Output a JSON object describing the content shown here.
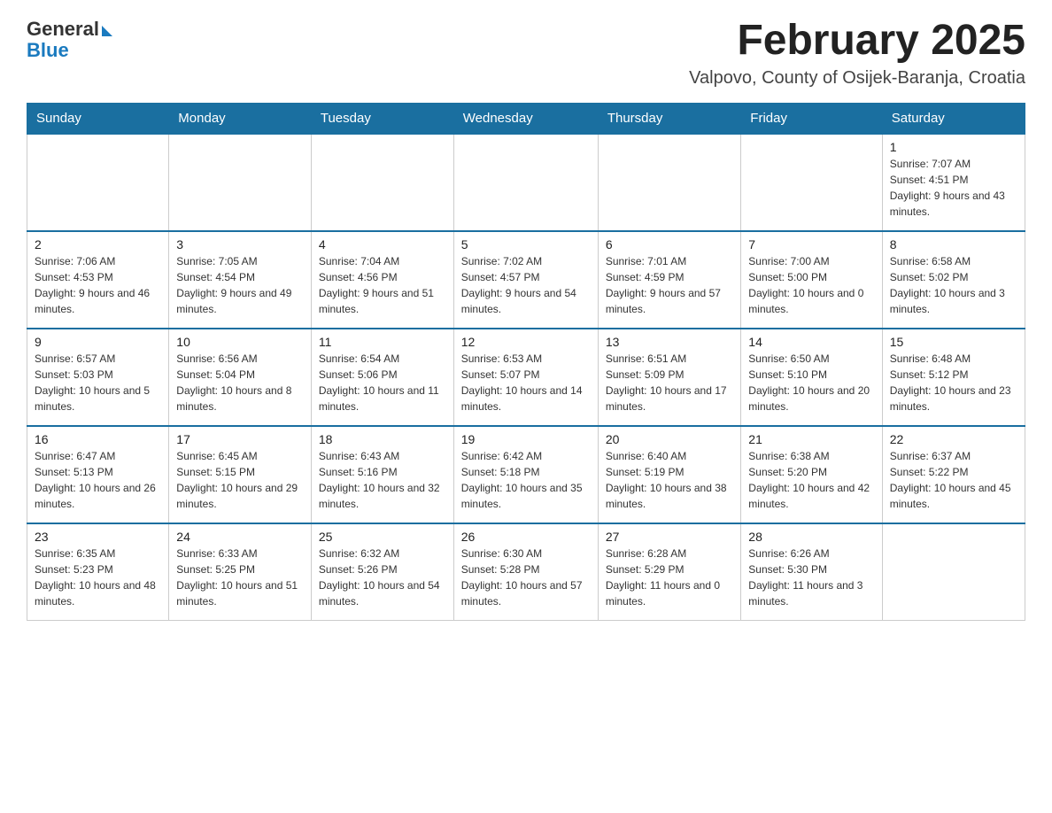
{
  "header": {
    "logo_general": "General",
    "logo_blue": "Blue",
    "month_title": "February 2025",
    "location": "Valpovo, County of Osijek-Baranja, Croatia"
  },
  "days_of_week": [
    "Sunday",
    "Monday",
    "Tuesday",
    "Wednesday",
    "Thursday",
    "Friday",
    "Saturday"
  ],
  "weeks": [
    [
      {
        "day": "",
        "info": ""
      },
      {
        "day": "",
        "info": ""
      },
      {
        "day": "",
        "info": ""
      },
      {
        "day": "",
        "info": ""
      },
      {
        "day": "",
        "info": ""
      },
      {
        "day": "",
        "info": ""
      },
      {
        "day": "1",
        "info": "Sunrise: 7:07 AM\nSunset: 4:51 PM\nDaylight: 9 hours and 43 minutes."
      }
    ],
    [
      {
        "day": "2",
        "info": "Sunrise: 7:06 AM\nSunset: 4:53 PM\nDaylight: 9 hours and 46 minutes."
      },
      {
        "day": "3",
        "info": "Sunrise: 7:05 AM\nSunset: 4:54 PM\nDaylight: 9 hours and 49 minutes."
      },
      {
        "day": "4",
        "info": "Sunrise: 7:04 AM\nSunset: 4:56 PM\nDaylight: 9 hours and 51 minutes."
      },
      {
        "day": "5",
        "info": "Sunrise: 7:02 AM\nSunset: 4:57 PM\nDaylight: 9 hours and 54 minutes."
      },
      {
        "day": "6",
        "info": "Sunrise: 7:01 AM\nSunset: 4:59 PM\nDaylight: 9 hours and 57 minutes."
      },
      {
        "day": "7",
        "info": "Sunrise: 7:00 AM\nSunset: 5:00 PM\nDaylight: 10 hours and 0 minutes."
      },
      {
        "day": "8",
        "info": "Sunrise: 6:58 AM\nSunset: 5:02 PM\nDaylight: 10 hours and 3 minutes."
      }
    ],
    [
      {
        "day": "9",
        "info": "Sunrise: 6:57 AM\nSunset: 5:03 PM\nDaylight: 10 hours and 5 minutes."
      },
      {
        "day": "10",
        "info": "Sunrise: 6:56 AM\nSunset: 5:04 PM\nDaylight: 10 hours and 8 minutes."
      },
      {
        "day": "11",
        "info": "Sunrise: 6:54 AM\nSunset: 5:06 PM\nDaylight: 10 hours and 11 minutes."
      },
      {
        "day": "12",
        "info": "Sunrise: 6:53 AM\nSunset: 5:07 PM\nDaylight: 10 hours and 14 minutes."
      },
      {
        "day": "13",
        "info": "Sunrise: 6:51 AM\nSunset: 5:09 PM\nDaylight: 10 hours and 17 minutes."
      },
      {
        "day": "14",
        "info": "Sunrise: 6:50 AM\nSunset: 5:10 PM\nDaylight: 10 hours and 20 minutes."
      },
      {
        "day": "15",
        "info": "Sunrise: 6:48 AM\nSunset: 5:12 PM\nDaylight: 10 hours and 23 minutes."
      }
    ],
    [
      {
        "day": "16",
        "info": "Sunrise: 6:47 AM\nSunset: 5:13 PM\nDaylight: 10 hours and 26 minutes."
      },
      {
        "day": "17",
        "info": "Sunrise: 6:45 AM\nSunset: 5:15 PM\nDaylight: 10 hours and 29 minutes."
      },
      {
        "day": "18",
        "info": "Sunrise: 6:43 AM\nSunset: 5:16 PM\nDaylight: 10 hours and 32 minutes."
      },
      {
        "day": "19",
        "info": "Sunrise: 6:42 AM\nSunset: 5:18 PM\nDaylight: 10 hours and 35 minutes."
      },
      {
        "day": "20",
        "info": "Sunrise: 6:40 AM\nSunset: 5:19 PM\nDaylight: 10 hours and 38 minutes."
      },
      {
        "day": "21",
        "info": "Sunrise: 6:38 AM\nSunset: 5:20 PM\nDaylight: 10 hours and 42 minutes."
      },
      {
        "day": "22",
        "info": "Sunrise: 6:37 AM\nSunset: 5:22 PM\nDaylight: 10 hours and 45 minutes."
      }
    ],
    [
      {
        "day": "23",
        "info": "Sunrise: 6:35 AM\nSunset: 5:23 PM\nDaylight: 10 hours and 48 minutes."
      },
      {
        "day": "24",
        "info": "Sunrise: 6:33 AM\nSunset: 5:25 PM\nDaylight: 10 hours and 51 minutes."
      },
      {
        "day": "25",
        "info": "Sunrise: 6:32 AM\nSunset: 5:26 PM\nDaylight: 10 hours and 54 minutes."
      },
      {
        "day": "26",
        "info": "Sunrise: 6:30 AM\nSunset: 5:28 PM\nDaylight: 10 hours and 57 minutes."
      },
      {
        "day": "27",
        "info": "Sunrise: 6:28 AM\nSunset: 5:29 PM\nDaylight: 11 hours and 0 minutes."
      },
      {
        "day": "28",
        "info": "Sunrise: 6:26 AM\nSunset: 5:30 PM\nDaylight: 11 hours and 3 minutes."
      },
      {
        "day": "",
        "info": ""
      }
    ]
  ]
}
